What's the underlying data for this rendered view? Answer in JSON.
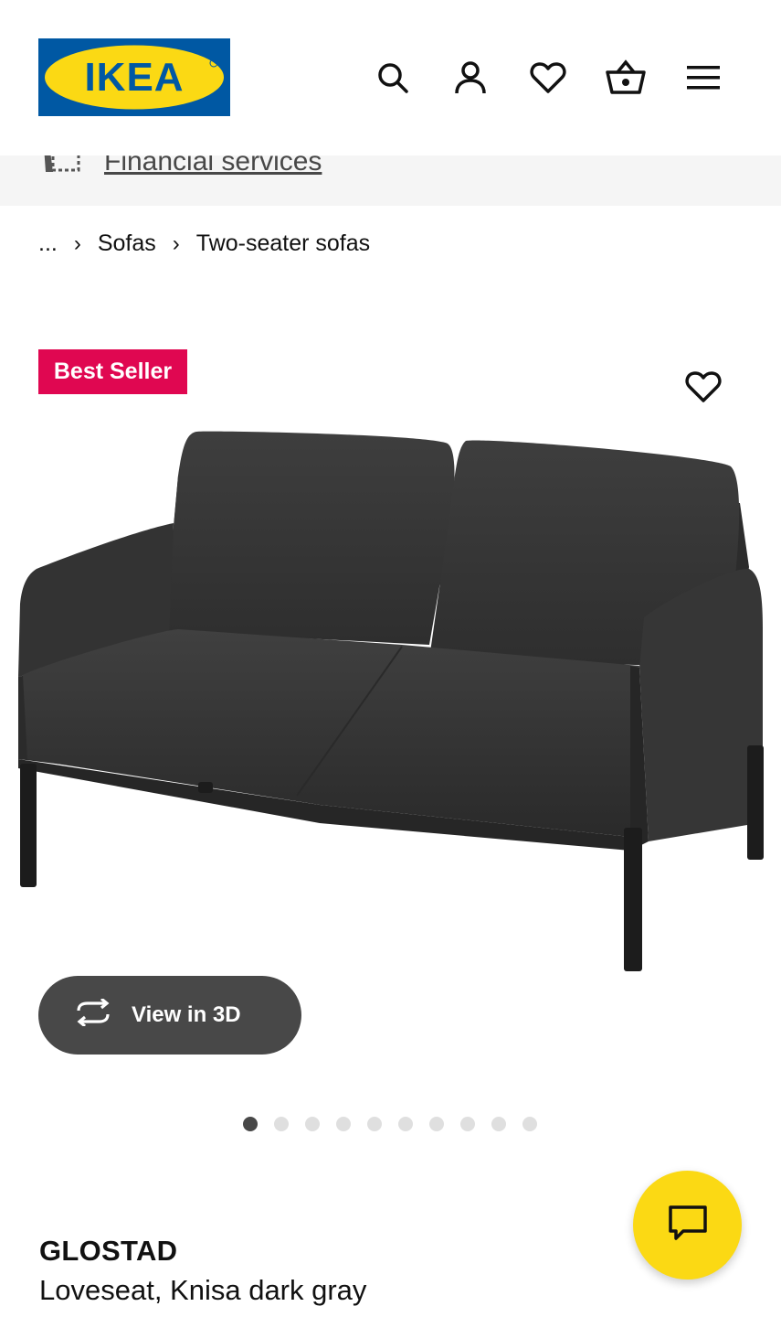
{
  "header": {
    "logo_text": "IKEA",
    "brand_colors": {
      "blue": "#0058a3",
      "yellow": "#fbd914"
    },
    "icons": [
      "search-icon",
      "account-icon",
      "heart-icon",
      "cart-icon",
      "menu-icon"
    ]
  },
  "financial": {
    "label": "Financial services",
    "icon": "card-icon"
  },
  "breadcrumb": {
    "ellipsis": "...",
    "items": [
      "Sofas",
      "Two-seater sofas"
    ],
    "separator": "›"
  },
  "badge": {
    "label": "Best Seller",
    "color": "#e00751"
  },
  "gallery": {
    "view3d_label": "View in 3D",
    "dots_total": 10,
    "active_dot": 1
  },
  "product": {
    "name": "GLOSTAD",
    "description": "Loveseat, Knisa dark gray"
  },
  "chat": {
    "icon": "chat-icon",
    "color": "#fbd914"
  }
}
